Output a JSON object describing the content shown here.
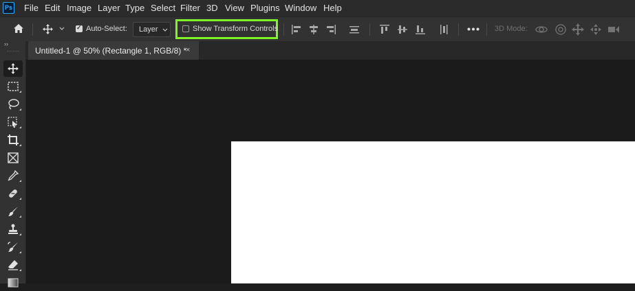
{
  "app": {
    "logo_text": "Ps"
  },
  "menu": [
    "File",
    "Edit",
    "Image",
    "Layer",
    "Type",
    "Select",
    "Filter",
    "3D",
    "View",
    "Plugins",
    "Window",
    "Help"
  ],
  "options_bar": {
    "auto_select_label": "Auto-Select:",
    "auto_select_checked": true,
    "target_value": "Layer",
    "show_transform_label": "Show Transform Controls",
    "show_transform_checked": false,
    "mode_label": "3D Mode:",
    "highlight_color": "#7ff528"
  },
  "document": {
    "tab_title": "Untitled-1 @ 50% (Rectangle 1, RGB/8) *",
    "close_glyph": "×"
  },
  "toolbar": {
    "expand_glyph": "››",
    "tools": [
      "move-tool",
      "marquee-tool",
      "lasso-tool",
      "object-select-tool",
      "crop-tool",
      "frame-tool",
      "eyedropper-tool",
      "healing-brush-tool",
      "brush-tool",
      "clone-stamp-tool",
      "history-brush-tool",
      "eraser-tool",
      "gradient-tool"
    ]
  }
}
